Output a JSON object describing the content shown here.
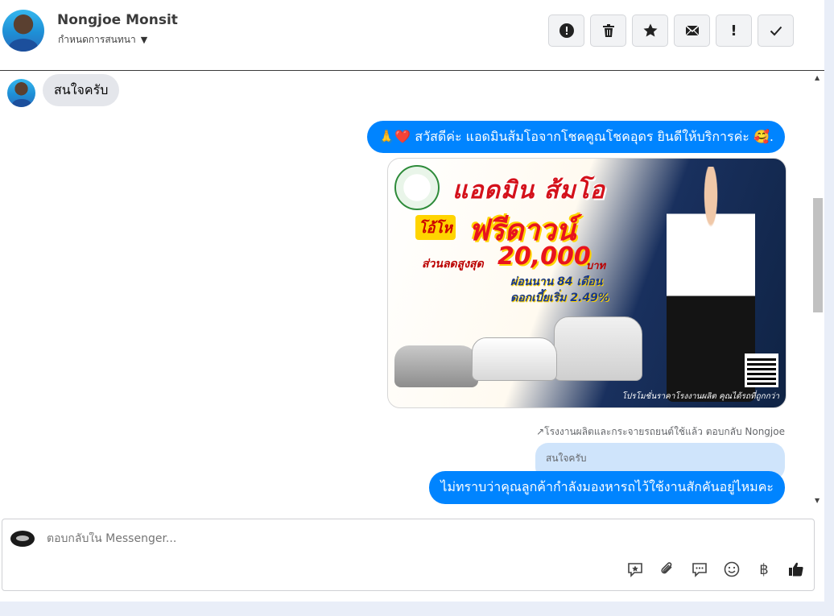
{
  "header": {
    "contact_name": "Nongjoe Monsit",
    "subtitle": "กำหนดการสนทนา",
    "actions": [
      {
        "name": "spam-button",
        "icon": "alert-circle-icon"
      },
      {
        "name": "delete-button",
        "icon": "trash-icon"
      },
      {
        "name": "star-button",
        "icon": "star-icon"
      },
      {
        "name": "mark-unread-button",
        "icon": "envelope-icon"
      },
      {
        "name": "priority-button",
        "icon": "exclamation-icon",
        "glyph": "!"
      },
      {
        "name": "done-button",
        "icon": "check-icon"
      }
    ]
  },
  "messages": {
    "incoming_1": "สนใจครับ",
    "outgoing_1": "🙏❤️ สวัสดีค่ะ แอดมินส้มโอจากโชคคูณโชคอุดร ยินดีให้บริการค่ะ 🥰.",
    "promo": {
      "headline": "แอดมิน ส้มโอ",
      "badge": "โอ้โห",
      "offer": "ฟรีดาวน์",
      "discount_label": "ส่วนลดสูงสุด",
      "discount_amount": "20,000",
      "currency": "บาท",
      "installment": "ผ่อนนาน 84 เดือน",
      "interest": "ดอกเบี้ยเริ่ม 2.49%",
      "footer": "โปรโมชั่นราคาโรงงานผลิต คุณได้รถที่ถูกกว่า"
    },
    "reply_hint": "↗โรงงานผลิตและกระจายรถยนต์ใช้แล้ว ตอบกลับ Nongjoe",
    "quoted_text": "สนใจครับ",
    "outgoing_2": "ไม่ทราบว่าคุณลูกค้ากำลังมองหารถไว้ใช้งานสักคันอยู่ไหมคะ"
  },
  "composer": {
    "placeholder": "ตอบกลับใน Messenger...",
    "tools": [
      {
        "name": "saved-reply-button",
        "icon": "star-bubble-icon"
      },
      {
        "name": "attach-button",
        "icon": "paperclip-icon"
      },
      {
        "name": "quick-reply-button",
        "icon": "chat-bubble-icon"
      },
      {
        "name": "emoji-button",
        "icon": "smiley-icon"
      },
      {
        "name": "payment-button",
        "icon": "baht-icon",
        "glyph": "฿"
      },
      {
        "name": "like-button",
        "icon": "thumbs-up-icon"
      }
    ]
  }
}
